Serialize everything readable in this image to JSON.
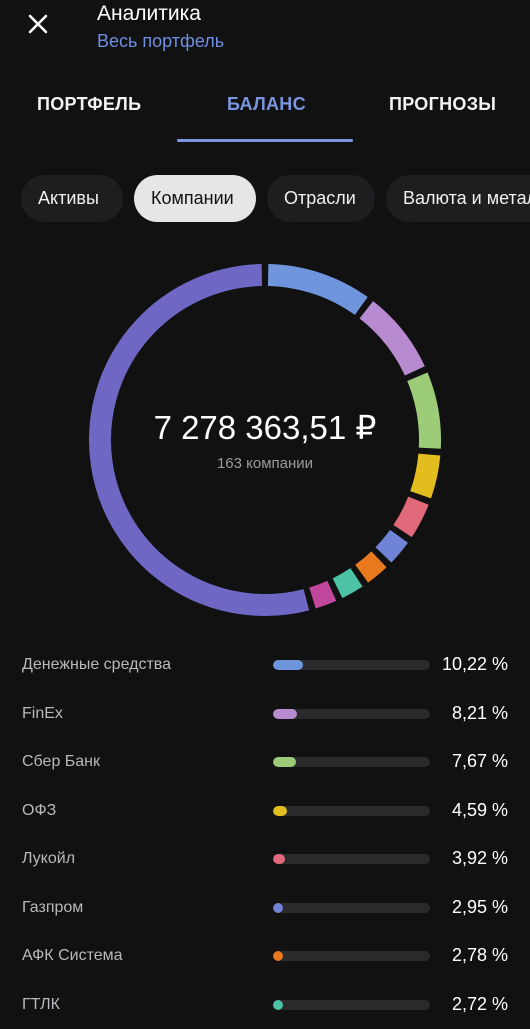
{
  "header": {
    "close_icon": "close-icon",
    "title": "Аналитика",
    "subtitle": "Весь портфель"
  },
  "tabs": [
    {
      "label": "ПОРТФЕЛЬ",
      "active": false
    },
    {
      "label": "БАЛАНС",
      "active": true
    },
    {
      "label": "ПРОГНОЗЫ",
      "active": false
    }
  ],
  "chips": [
    {
      "label": "Активы",
      "active": false
    },
    {
      "label": "Компании",
      "active": true
    },
    {
      "label": "Отрасли",
      "active": false
    },
    {
      "label": "Валюта и металлы",
      "active": false
    }
  ],
  "summary": {
    "total": "7 278 363,51 ₽",
    "count": "163 компании"
  },
  "colors": {
    "accent": "#7a96e0",
    "track": "#2a2a2d",
    "rest_segment": "#6e68c4"
  },
  "companies": [
    {
      "name": "Денежные средства",
      "percent_text": "10,22 %",
      "value": 10.22,
      "color": "#6f96dc"
    },
    {
      "name": "FinEx",
      "percent_text": "8,21 %",
      "value": 8.21,
      "color": "#b88ad0"
    },
    {
      "name": "Сбер Банк",
      "percent_text": "7,67 %",
      "value": 7.67,
      "color": "#9ccc78"
    },
    {
      "name": "ОФЗ",
      "percent_text": "4,59 %",
      "value": 4.59,
      "color": "#e2bd1e"
    },
    {
      "name": "Лукойл",
      "percent_text": "3,92 %",
      "value": 3.92,
      "color": "#e06a7a"
    },
    {
      "name": "Газпром",
      "percent_text": "2,95 %",
      "value": 2.95,
      "color": "#6f84d6"
    },
    {
      "name": "АФК Система",
      "percent_text": "2,78 %",
      "value": 2.78,
      "color": "#e8791e"
    },
    {
      "name": "ГТЛК",
      "percent_text": "2,72 %",
      "value": 2.72,
      "color": "#4cc3a5"
    }
  ],
  "donut_extra_segments": [
    {
      "value": 2.6,
      "color": "#c0479c"
    },
    {
      "value": 54.34,
      "color": "#6e68c4"
    }
  ]
}
